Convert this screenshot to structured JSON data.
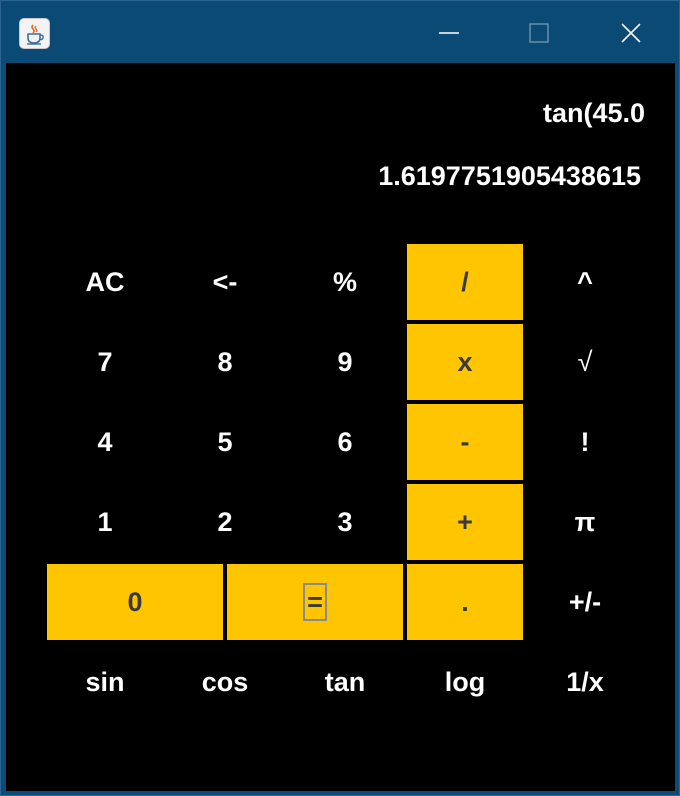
{
  "window": {
    "icon": "java-cup-icon",
    "controls": {
      "minimize": "minimize-icon",
      "maximize": "maximize-icon",
      "close": "close-icon"
    }
  },
  "display": {
    "expression": "tan(45.0",
    "result": "1.6197751905438615"
  },
  "colors": {
    "background": "#000000",
    "accent": "#ffc500",
    "titlebar": "#0b4a74",
    "text": "#ffffff"
  },
  "keys": {
    "ac": "AC",
    "back": "<-",
    "percent": "%",
    "divide": "/",
    "power": "^",
    "seven": "7",
    "eight": "8",
    "nine": "9",
    "multiply": "x",
    "sqrt": "√",
    "four": "4",
    "five": "5",
    "six": "6",
    "minus": "-",
    "factorial": "!",
    "one": "1",
    "two": "2",
    "three": "3",
    "plus": "+",
    "pi": "π",
    "zero": "0",
    "equals": "=",
    "dot": ".",
    "negate": "+/-",
    "sin": "sin",
    "cos": "cos",
    "tan": "tan",
    "log": "log",
    "reciprocal": "1/x"
  }
}
